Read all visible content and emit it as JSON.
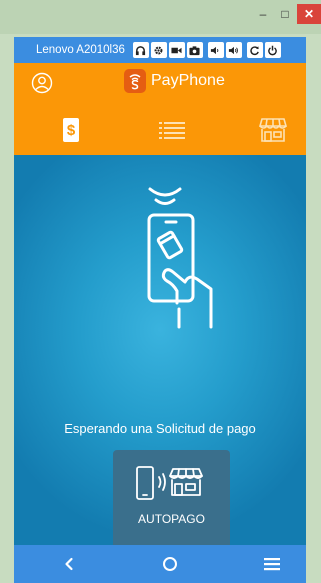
{
  "window": {
    "minimize_glyph": "–",
    "maximize_glyph": "□",
    "close_glyph": "✕"
  },
  "device_bar": {
    "device_name": "Lenovo A2010l36",
    "tools": [
      "headset-icon",
      "gear-icon",
      "video-camera-icon",
      "camera-icon",
      "volume-down-icon",
      "volume-up-icon",
      "rotate-icon",
      "power-icon"
    ]
  },
  "app": {
    "name": "PayPhone",
    "header_color": "#fb9707",
    "tabs": [
      {
        "name": "tab-payments",
        "icon": "dollar-icon",
        "glyph": "$",
        "active": true
      },
      {
        "name": "tab-history",
        "icon": "list-icon",
        "active": false
      },
      {
        "name": "tab-store",
        "icon": "store-icon",
        "active": false
      }
    ]
  },
  "main": {
    "status_text": "Esperando una Solicitud de pago",
    "autopago_label": "AUTOPAGO"
  },
  "nav_bar": {
    "buttons": [
      "back-icon",
      "home-icon",
      "menu-icon"
    ],
    "color": "#3b8de0"
  }
}
